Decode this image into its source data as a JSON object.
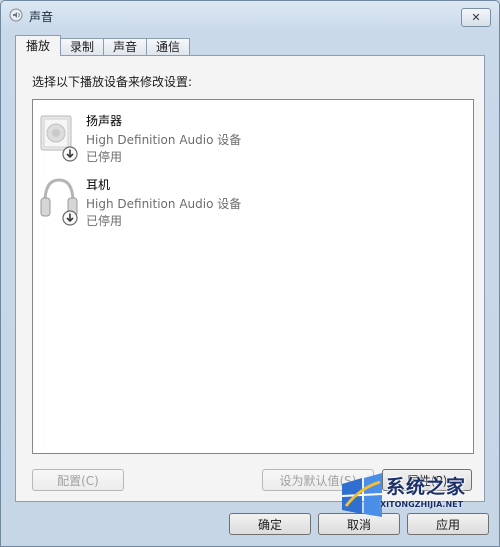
{
  "window": {
    "title": "声音",
    "close_label": "✕"
  },
  "tabs": [
    {
      "label": "播放",
      "active": true
    },
    {
      "label": "录制",
      "active": false
    },
    {
      "label": "声音",
      "active": false
    },
    {
      "label": "通信",
      "active": false
    }
  ],
  "panel": {
    "instruction": "选择以下播放设备来修改设置:"
  },
  "devices": [
    {
      "name": "扬声器",
      "description": "High Definition Audio 设备",
      "status": "已停用",
      "icon": "speaker-icon"
    },
    {
      "name": "耳机",
      "description": "High Definition Audio 设备",
      "status": "已停用",
      "icon": "headphones-icon"
    }
  ],
  "panel_buttons": {
    "configure": "配置(C)",
    "set_default": "设为默认值(S)",
    "properties": "属性(P)"
  },
  "dialog_buttons": {
    "ok": "确定",
    "cancel": "取消",
    "apply": "应用"
  },
  "watermark": {
    "main": "系统之家",
    "sub": "XITONGZHIJIA.NET"
  },
  "colors": {
    "title_bar": "#c9d9ea",
    "panel_bg": "#f4f4f4",
    "disabled_text": "#a0a0a0",
    "watermark": "#1b2f6a"
  }
}
